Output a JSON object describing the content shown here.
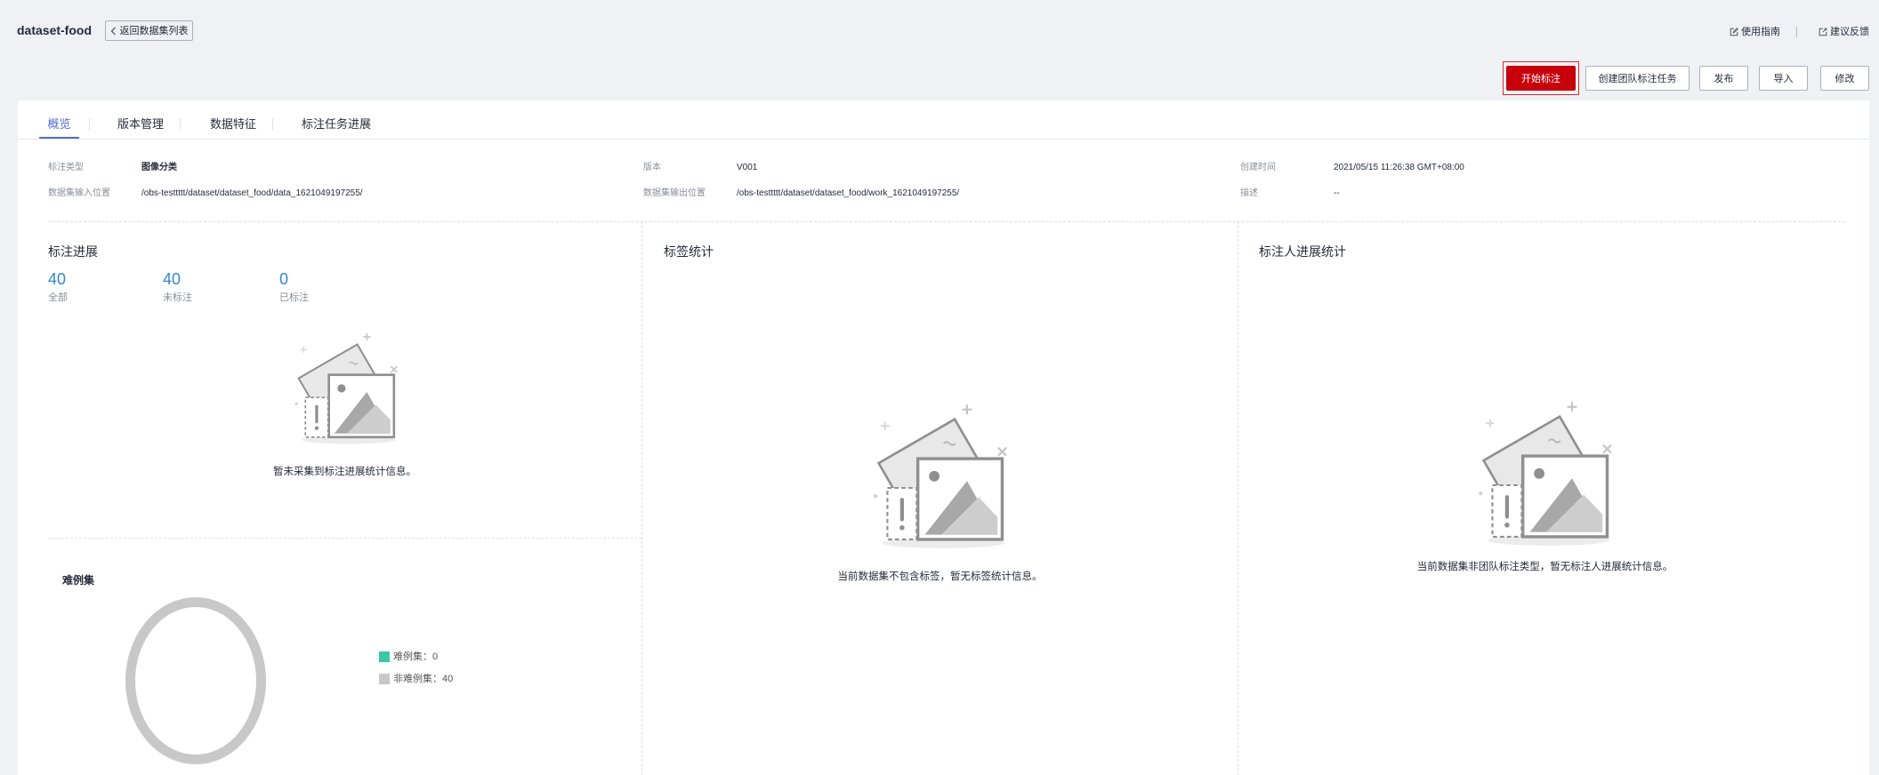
{
  "theme": {
    "page_bg": "#eff1f5",
    "primary": "#c7000b",
    "tab_active": "#526ecc",
    "stat_number": "#3388cc"
  },
  "header": {
    "title": "dataset-food",
    "back_button": {
      "label": "返回数据集列表",
      "icon": "chevron-left-icon"
    },
    "links": [
      {
        "label": "使用指南",
        "icon": "edit-icon"
      },
      {
        "label": "建议反馈",
        "icon": "feedback-icon"
      }
    ]
  },
  "actions": [
    {
      "label": "开始标注",
      "primary": true
    },
    {
      "label": "创建团队标注任务"
    },
    {
      "label": "发布"
    },
    {
      "label": "导入"
    },
    {
      "label": "修改"
    }
  ],
  "tabs": [
    {
      "label": "概览",
      "active": true
    },
    {
      "label": "版本管理"
    },
    {
      "label": "数据特征"
    },
    {
      "label": "标注任务进展"
    }
  ],
  "info": {
    "annotation_type": {
      "label": "标注类型",
      "value": "图像分类"
    },
    "version": {
      "label": "版本",
      "value": "V001"
    },
    "created_time": {
      "label": "创建时间",
      "value": "2021/05/15 11:26:38 GMT+08:00"
    },
    "input_location": {
      "label": "数据集输入位置",
      "value": "/obs-testtttt/dataset/dataset_food/data_1621049197255/"
    },
    "output_location": {
      "label": "数据集输出位置",
      "value": "/obs-testtttt/dataset/dataset_food/work_1621049197255/"
    },
    "description": {
      "label": "描述",
      "value": "--"
    }
  },
  "progress": {
    "title": "标注进展",
    "stats": [
      {
        "value": "40",
        "label": "全部"
      },
      {
        "value": "40",
        "label": "未标注"
      },
      {
        "value": "0",
        "label": "已标注"
      }
    ],
    "empty_text": "暂未采集到标注进展统计信息。"
  },
  "label_stats": {
    "title": "标签统计",
    "empty_text": "当前数据集不包含标签，暂无标签统计信息。"
  },
  "annotator_stats": {
    "title": "标注人进展统计",
    "empty_text": "当前数据集非团队标注类型，暂无标注人进展统计信息。"
  },
  "chart_data": {
    "type": "pie",
    "title": "难例集",
    "series": [
      {
        "label": "难例集：0",
        "value": 0,
        "color": "#3cc7a7"
      },
      {
        "label": "非难例集：40",
        "value": 40,
        "color": "#c8c8c8"
      }
    ]
  }
}
